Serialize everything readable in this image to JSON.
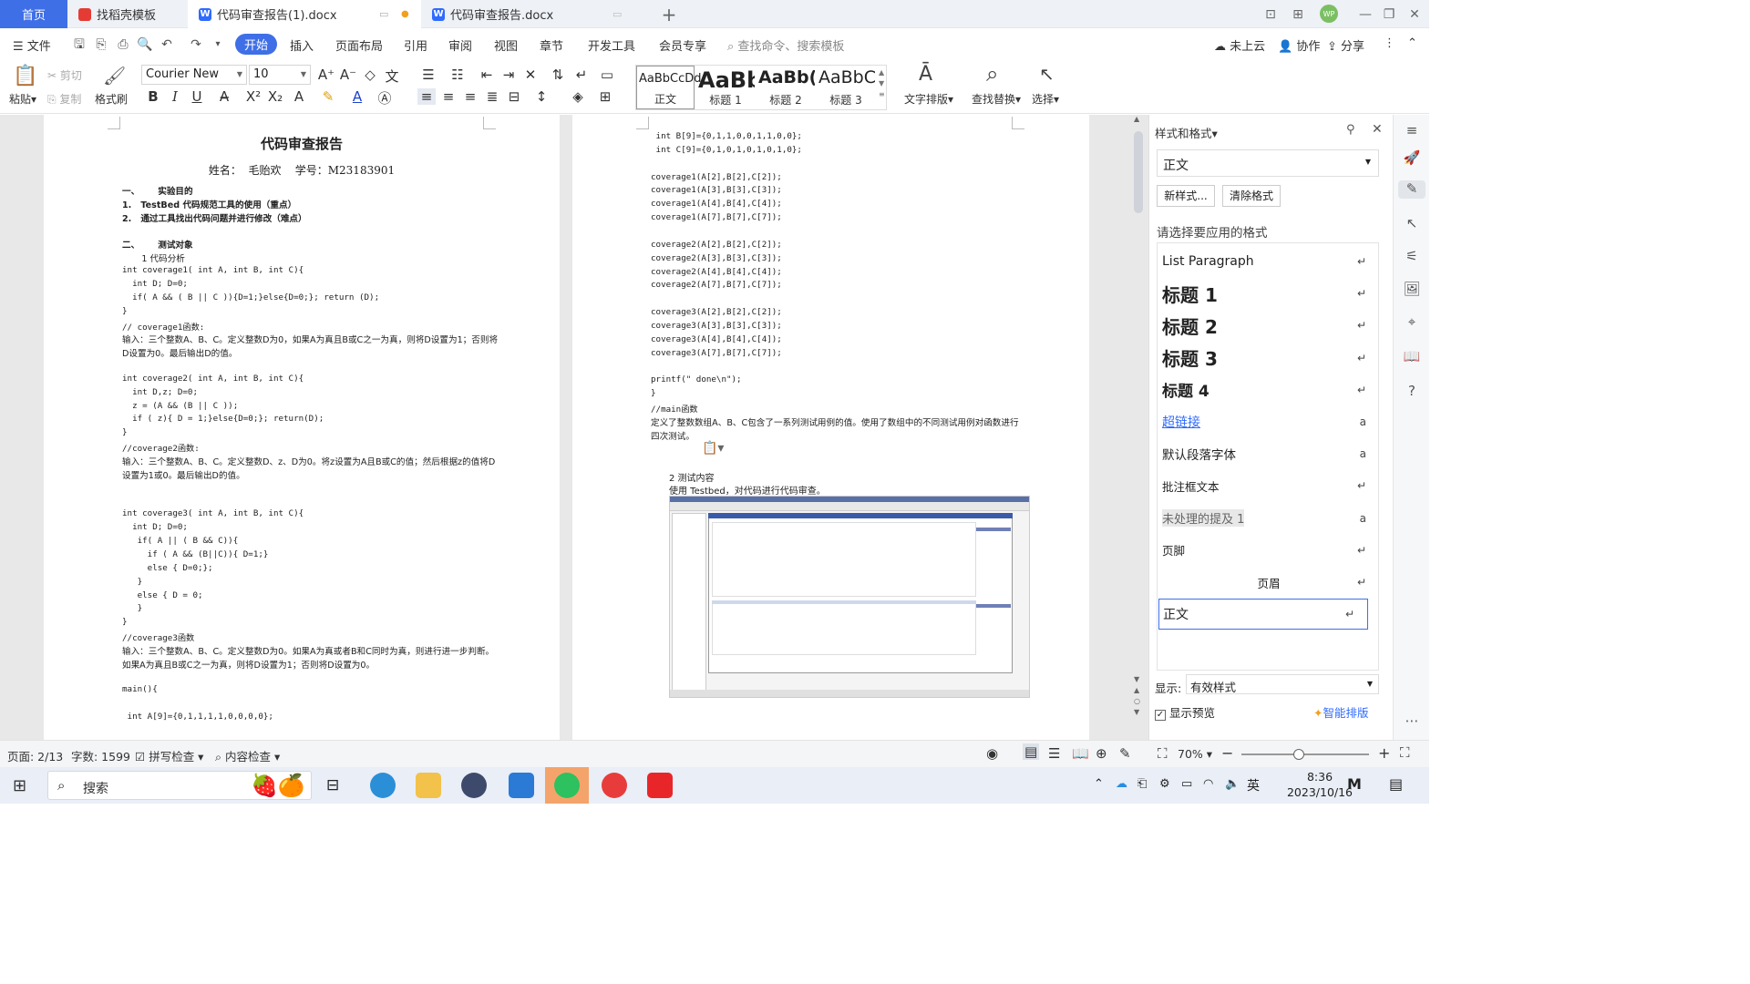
{
  "tabs": {
    "home": "首页",
    "template": "找稻壳模板",
    "doc1": "代码审查报告(1).docx",
    "doc2": "代码审查报告.docx"
  },
  "avatar_text": "WP",
  "menu": {
    "file": "文件",
    "items": [
      "开始",
      "插入",
      "页面布局",
      "引用",
      "审阅",
      "视图",
      "章节",
      "开发工具",
      "会员专享"
    ],
    "search": "查找命令、搜索模板",
    "cloud": "未上云",
    "collab": "协作",
    "share": "分享"
  },
  "ribbon": {
    "paste": "粘贴",
    "cut": "剪切",
    "copy": "复制",
    "format_painter": "格式刷",
    "font": "Courier New",
    "size": "10",
    "styles": [
      {
        "preview": "AaBbCcDd",
        "name": "正文"
      },
      {
        "preview": "AaBb",
        "name": "标题 1"
      },
      {
        "preview": "AaBb(",
        "name": "标题 2"
      },
      {
        "preview": "AaBbC",
        "name": "标题 3"
      }
    ],
    "text_layout": "文字排版",
    "find_replace": "查找替换",
    "select": "选择"
  },
  "page1": {
    "title": "代码审查报告",
    "subtitle": "姓名：  毛贻欢    学号：M23183901",
    "lines": [
      {
        "t": "一、      实验目的",
        "b": true
      },
      {
        "t": "1.   TestBed 代码规范工具的使用（重点）",
        "b": true
      },
      {
        "t": "2.   通过工具找出代码问题并进行修改（难点）",
        "b": true
      },
      {
        "t": "",
        "b": false
      },
      {
        "t": "二、      测试对象",
        "b": true
      },
      {
        "t": "       1 代码分析",
        "b": false
      },
      {
        "t": "int coverage1( int A, int B, int C){",
        "m": true
      },
      {
        "t": "  int D; D=0;",
        "m": true
      },
      {
        "t": "  if( A && ( B || C )){D=1;}else{D=0;}; return (D);",
        "m": true
      },
      {
        "t": "}",
        "m": true
      },
      {
        "t": "// coverage1函数:",
        "m": true
      },
      {
        "t": "输入：三个整数A、B、C。定义整数D为0，如果A为真且B或C之一为真，则将D设置为1；否则将",
        "b": false
      },
      {
        "t": "D设置为0。最后输出D的值。",
        "b": false
      },
      {
        "t": "",
        "b": false
      },
      {
        "t": "int coverage2( int A, int B, int C){",
        "m": true
      },
      {
        "t": "  int D,z; D=0;",
        "m": true
      },
      {
        "t": "  z = (A && (B || C ));",
        "m": true
      },
      {
        "t": "  if ( z){ D = 1;}else{D=0;}; return(D);",
        "m": true
      },
      {
        "t": "}",
        "m": true
      },
      {
        "t": "//coverage2函数:",
        "m": true
      },
      {
        "t": "输入：三个整数A、B、C。定义整数D、z、D为0。将z设置为A且B或C的值；然后根据z的值将D",
        "b": false
      },
      {
        "t": "设置为1或0。最后输出D的值。",
        "b": false
      },
      {
        "t": "",
        "b": false
      },
      {
        "t": "",
        "b": false
      },
      {
        "t": "int coverage3( int A, int B, int C){",
        "m": true
      },
      {
        "t": "  int D; D=0;",
        "m": true
      },
      {
        "t": "   if( A || ( B && C)){",
        "m": true
      },
      {
        "t": "     if ( A && (B||C)){ D=1;}",
        "m": true
      },
      {
        "t": "     else { D=0;};",
        "m": true
      },
      {
        "t": "   }",
        "m": true
      },
      {
        "t": "   else { D = 0;",
        "m": true
      },
      {
        "t": "   }",
        "m": true
      },
      {
        "t": "}",
        "m": true
      },
      {
        "t": "//coverage3函数",
        "m": true
      },
      {
        "t": "输入：三个整数A、B、C。定义整数D为0。如果A为真或者B和C同时为真，则进行进一步判断。",
        "b": false
      },
      {
        "t": "如果A为真且B或C之一为真，则将D设置为1；否则将D设置为0。",
        "b": false
      },
      {
        "t": "",
        "b": false
      },
      {
        "t": "main(){",
        "m": true
      },
      {
        "t": "",
        "b": false
      },
      {
        "t": " int A[9]={0,1,1,1,1,0,0,0,0};",
        "m": true
      }
    ]
  },
  "page2": {
    "lines": [
      {
        "t": " int B[9]={0,1,1,0,0,1,1,0,0};",
        "m": true
      },
      {
        "t": " int C[9]={0,1,0,1,0,1,0,1,0};",
        "m": true
      },
      {
        "t": "",
        "m": true
      },
      {
        "t": "coverage1(A[2],B[2],C[2]);",
        "m": true
      },
      {
        "t": "coverage1(A[3],B[3],C[3]);",
        "m": true
      },
      {
        "t": "coverage1(A[4],B[4],C[4]);",
        "m": true
      },
      {
        "t": "coverage1(A[7],B[7],C[7]);",
        "m": true
      },
      {
        "t": "",
        "m": true
      },
      {
        "t": "coverage2(A[2],B[2],C[2]);",
        "m": true
      },
      {
        "t": "coverage2(A[3],B[3],C[3]);",
        "m": true
      },
      {
        "t": "coverage2(A[4],B[4],C[4]);",
        "m": true
      },
      {
        "t": "coverage2(A[7],B[7],C[7]);",
        "m": true
      },
      {
        "t": "",
        "m": true
      },
      {
        "t": "coverage3(A[2],B[2],C[2]);",
        "m": true
      },
      {
        "t": "coverage3(A[3],B[3],C[3]);",
        "m": true
      },
      {
        "t": "coverage3(A[4],B[4],C[4]);",
        "m": true
      },
      {
        "t": "coverage3(A[7],B[7],C[7]);",
        "m": true
      },
      {
        "t": "",
        "m": true
      },
      {
        "t": "printf(\" done\\n\");",
        "m": true
      },
      {
        "t": "}",
        "m": true
      },
      {
        "t": "//main函数",
        "m": true
      },
      {
        "t": "定义了整数数组A、B、C包含了一系列测试用例的值。使用了数组中的不同测试用例对函数进行",
        "m": false
      },
      {
        "t": "四次测试。",
        "m": false
      }
    ],
    "section": "2 测试内容",
    "section_desc": "使用 Testbed，对代码进行代码审查。"
  },
  "panel": {
    "title": "样式和格式",
    "current": "正文",
    "new_style": "新样式...",
    "clear_format": "清除格式",
    "prompt": "请选择要应用的格式",
    "styles": [
      {
        "name": "List Paragraph",
        "mark": "↵"
      },
      {
        "name": "标题 1",
        "mark": "↵"
      },
      {
        "name": "标题 2",
        "mark": "↵"
      },
      {
        "name": "标题 3",
        "mark": "↵"
      },
      {
        "name": "标题 4",
        "mark": "↵"
      },
      {
        "name": "超链接",
        "mark": "a"
      },
      {
        "name": "默认段落字体",
        "mark": "a"
      },
      {
        "name": "批注框文本",
        "mark": "↵"
      },
      {
        "name": "未处理的提及 1",
        "mark": "a"
      },
      {
        "name": "页脚",
        "mark": "↵"
      },
      {
        "name": "页眉",
        "mark": "↵"
      },
      {
        "name": "正文",
        "mark": "↵"
      }
    ],
    "show_label": "显示:",
    "show_value": "有效样式",
    "preview": "显示预览",
    "smart": "智能排版"
  },
  "status": {
    "page": "页面: 2/13",
    "words": "字数: 1599",
    "spell": "拼写检查",
    "content": "内容检查",
    "zoom": "70%",
    "zoom_value": 0.45
  },
  "taskbar": {
    "search": "搜索",
    "lang": "英",
    "time": "8:36",
    "date": "2023/10/16"
  },
  "colors": {
    "accent": "#3f6fe6",
    "link": "#2f6bff"
  }
}
